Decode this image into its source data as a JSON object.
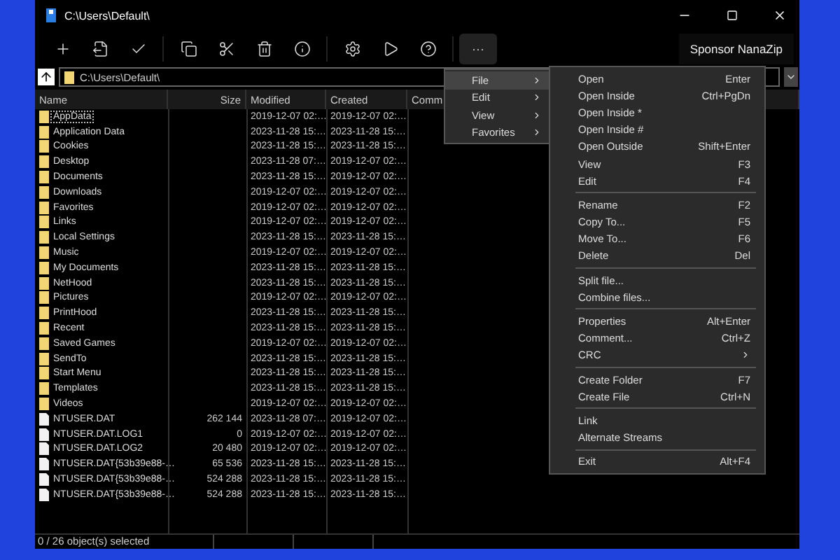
{
  "window": {
    "title": "C:\\Users\\Default\\"
  },
  "toolbar": {
    "more_label": "···",
    "sponsor_label": "Sponsor NanaZip"
  },
  "address": {
    "path": "C:\\Users\\Default\\"
  },
  "columns": [
    "Name",
    "Size",
    "Modified",
    "Created",
    "Comm"
  ],
  "rows": [
    {
      "kind": "folder",
      "name": "AppData",
      "size": "",
      "modified": "2019-12-07 02:…",
      "created": "2019-12-07 02:…",
      "focused": true
    },
    {
      "kind": "folder",
      "name": "Application Data",
      "size": "",
      "modified": "2023-11-28 15:…",
      "created": "2023-11-28 15:…",
      "focused": false
    },
    {
      "kind": "folder",
      "name": "Cookies",
      "size": "",
      "modified": "2023-11-28 15:…",
      "created": "2023-11-28 15:…",
      "focused": false
    },
    {
      "kind": "folder",
      "name": "Desktop",
      "size": "",
      "modified": "2023-11-28 07:…",
      "created": "2019-12-07 02:…",
      "focused": false
    },
    {
      "kind": "folder",
      "name": "Documents",
      "size": "",
      "modified": "2023-11-28 15:…",
      "created": "2019-12-07 02:…",
      "focused": false
    },
    {
      "kind": "folder",
      "name": "Downloads",
      "size": "",
      "modified": "2019-12-07 02:…",
      "created": "2019-12-07 02:…",
      "focused": false
    },
    {
      "kind": "folder",
      "name": "Favorites",
      "size": "",
      "modified": "2019-12-07 02:…",
      "created": "2019-12-07 02:…",
      "focused": false
    },
    {
      "kind": "folder",
      "name": "Links",
      "size": "",
      "modified": "2019-12-07 02:…",
      "created": "2019-12-07 02:…",
      "focused": false
    },
    {
      "kind": "folder",
      "name": "Local Settings",
      "size": "",
      "modified": "2023-11-28 15:…",
      "created": "2023-11-28 15:…",
      "focused": false
    },
    {
      "kind": "folder",
      "name": "Music",
      "size": "",
      "modified": "2019-12-07 02:…",
      "created": "2019-12-07 02:…",
      "focused": false
    },
    {
      "kind": "folder",
      "name": "My Documents",
      "size": "",
      "modified": "2023-11-28 15:…",
      "created": "2023-11-28 15:…",
      "focused": false
    },
    {
      "kind": "folder",
      "name": "NetHood",
      "size": "",
      "modified": "2023-11-28 15:…",
      "created": "2023-11-28 15:…",
      "focused": false
    },
    {
      "kind": "folder",
      "name": "Pictures",
      "size": "",
      "modified": "2019-12-07 02:…",
      "created": "2019-12-07 02:…",
      "focused": false
    },
    {
      "kind": "folder",
      "name": "PrintHood",
      "size": "",
      "modified": "2023-11-28 15:…",
      "created": "2023-11-28 15:…",
      "focused": false
    },
    {
      "kind": "folder",
      "name": "Recent",
      "size": "",
      "modified": "2023-11-28 15:…",
      "created": "2023-11-28 15:…",
      "focused": false
    },
    {
      "kind": "folder",
      "name": "Saved Games",
      "size": "",
      "modified": "2019-12-07 02:…",
      "created": "2019-12-07 02:…",
      "focused": false
    },
    {
      "kind": "folder",
      "name": "SendTo",
      "size": "",
      "modified": "2023-11-28 15:…",
      "created": "2023-11-28 15:…",
      "focused": false
    },
    {
      "kind": "folder",
      "name": "Start Menu",
      "size": "",
      "modified": "2023-11-28 15:…",
      "created": "2023-11-28 15:…",
      "focused": false
    },
    {
      "kind": "folder",
      "name": "Templates",
      "size": "",
      "modified": "2023-11-28 15:…",
      "created": "2023-11-28 15:…",
      "focused": false
    },
    {
      "kind": "folder",
      "name": "Videos",
      "size": "",
      "modified": "2019-12-07 02:…",
      "created": "2019-12-07 02:…",
      "focused": false
    },
    {
      "kind": "file",
      "name": "NTUSER.DAT",
      "size": "262 144",
      "modified": "2023-11-28 07:…",
      "created": "2019-12-07 02:…",
      "focused": false
    },
    {
      "kind": "file",
      "name": "NTUSER.DAT.LOG1",
      "size": "0",
      "modified": "2019-12-07 02:…",
      "created": "2019-12-07 02:…",
      "focused": false
    },
    {
      "kind": "file",
      "name": "NTUSER.DAT.LOG2",
      "size": "20 480",
      "modified": "2019-12-07 02:…",
      "created": "2019-12-07 02:…",
      "focused": false
    },
    {
      "kind": "file",
      "name": "NTUSER.DAT{53b39e88-…",
      "size": "65 536",
      "modified": "2023-11-28 15:…",
      "created": "2023-11-28 15:…",
      "focused": false
    },
    {
      "kind": "file",
      "name": "NTUSER.DAT{53b39e88-…",
      "size": "524 288",
      "modified": "2023-11-28 15:…",
      "created": "2023-11-28 15:…",
      "focused": false
    },
    {
      "kind": "file",
      "name": "NTUSER.DAT{53b39e88-…",
      "size": "524 288",
      "modified": "2023-11-28 15:…",
      "created": "2023-11-28 15:…",
      "focused": false
    }
  ],
  "status_bar": "0 / 26 object(s) selected",
  "menu": [
    {
      "label": "File",
      "selected": true
    },
    {
      "label": "Edit",
      "selected": false
    },
    {
      "label": "View",
      "selected": false
    },
    {
      "label": "Favorites",
      "selected": false
    }
  ],
  "submenu": [
    {
      "kind": "item",
      "label": "Open",
      "shortcut": "Enter",
      "has_submenu": false
    },
    {
      "kind": "item",
      "label": "Open Inside",
      "shortcut": "Ctrl+PgDn",
      "has_submenu": false
    },
    {
      "kind": "item",
      "label": "Open Inside *",
      "has_submenu": false
    },
    {
      "kind": "item",
      "label": "Open Inside #",
      "has_submenu": false
    },
    {
      "kind": "item",
      "label": "Open Outside",
      "shortcut": "Shift+Enter",
      "has_submenu": false
    },
    {
      "kind": "item",
      "label": "View",
      "shortcut": "F3",
      "has_submenu": false
    },
    {
      "kind": "item",
      "label": "Edit",
      "shortcut": "F4",
      "has_submenu": false
    },
    {
      "kind": "separator"
    },
    {
      "kind": "item",
      "label": "Rename",
      "shortcut": "F2",
      "has_submenu": false
    },
    {
      "kind": "item",
      "label": "Copy To...",
      "shortcut": "F5",
      "has_submenu": false
    },
    {
      "kind": "item",
      "label": "Move To...",
      "shortcut": "F6",
      "has_submenu": false
    },
    {
      "kind": "item",
      "label": "Delete",
      "shortcut": "Del",
      "has_submenu": false
    },
    {
      "kind": "separator"
    },
    {
      "kind": "item",
      "label": "Split file...",
      "has_submenu": false
    },
    {
      "kind": "item",
      "label": "Combine files...",
      "has_submenu": false
    },
    {
      "kind": "separator"
    },
    {
      "kind": "item",
      "label": "Properties",
      "shortcut": "Alt+Enter",
      "has_submenu": false
    },
    {
      "kind": "item",
      "label": "Comment...",
      "shortcut": "Ctrl+Z",
      "has_submenu": false
    },
    {
      "kind": "item",
      "label": "CRC",
      "has_submenu": true
    },
    {
      "kind": "separator"
    },
    {
      "kind": "item",
      "label": "Create Folder",
      "shortcut": "F7",
      "has_submenu": false
    },
    {
      "kind": "item",
      "label": "Create File",
      "shortcut": "Ctrl+N",
      "has_submenu": false
    },
    {
      "kind": "separator"
    },
    {
      "kind": "item",
      "label": "Link",
      "has_submenu": false
    },
    {
      "kind": "item",
      "label": "Alternate Streams",
      "has_submenu": false
    },
    {
      "kind": "separator"
    },
    {
      "kind": "item",
      "label": "Exit",
      "shortcut": "Alt+F4",
      "has_submenu": false
    }
  ]
}
